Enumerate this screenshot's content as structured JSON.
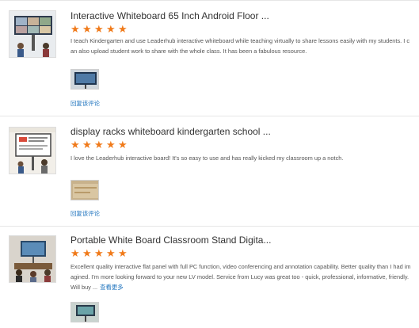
{
  "colors": {
    "star": "#f07a1a",
    "link": "#1e73be",
    "divider": "#e6e6e6"
  },
  "reviews": [
    {
      "product_title": "Interactive Whiteboard 65 Inch Android Floor ...",
      "rating": 5,
      "stars_icon": "star-icon",
      "text": "I teach Kindergarten and use Leaderhub interactive whiteboard while teaching virtually to share lessons easily with my students. I can also upload student work to share with the whole class. It has been a fabulous resource.",
      "see_more": "",
      "reply_label": "回复该评论"
    },
    {
      "product_title": "display racks whiteboard kindergarten school ...",
      "rating": 5,
      "stars_icon": "star-icon",
      "text": "I love the Leaderhub  interactive board! It's so easy to use and has really kicked my classroom up a notch.",
      "see_more": "",
      "reply_label": "回复该评论"
    },
    {
      "product_title": "Portable White Board Classroom Stand Digita...",
      "rating": 5,
      "stars_icon": "star-icon",
      "text": "Excellent quality interactive flat panel with full PC function, video conferencing and annotation capability. Better quality than I had imagined. I'm more looking forward to your new LV model. Service from Lucy was great too - quick, professional, informative, friendly. Will buy ...",
      "see_more": "查看更多",
      "reply_label": ""
    }
  ]
}
